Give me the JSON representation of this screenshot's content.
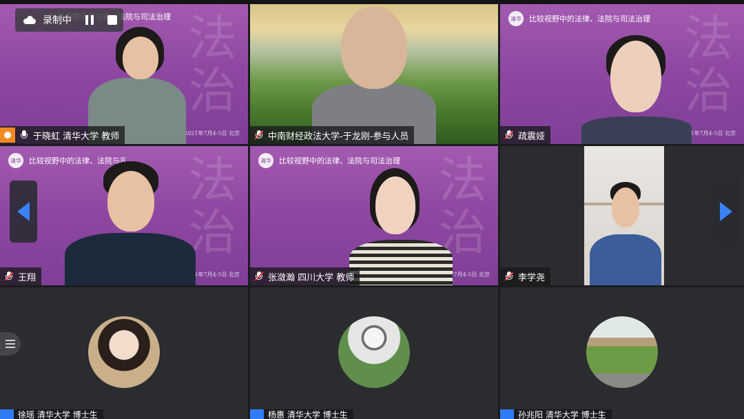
{
  "recording": {
    "label": "录制中"
  },
  "conference": {
    "banner": "比较视野中的法律、法院与司法治理",
    "date": "2021年7月4-5日 北京",
    "seal": "清华",
    "watermark": "法治"
  },
  "tiles": [
    {
      "name": "于晓虹 清华大学 教师",
      "muted": false
    },
    {
      "name": "中南财经政法大学-于龙刚-参与人员",
      "muted": true
    },
    {
      "name": "疏震娅",
      "muted": true
    },
    {
      "name": "王翔",
      "muted": true
    },
    {
      "name": "张潋瀚 四川大学 教师",
      "muted": true
    },
    {
      "name": "李学尧",
      "muted": true
    },
    {
      "name": "徐瑶 清华大学 博士生",
      "muted": true
    },
    {
      "name": "杨惠 清华大学 博士生",
      "muted": true
    },
    {
      "name": "孙兆阳 清华大学 博士生",
      "muted": true
    }
  ],
  "icons": {
    "cloud": "cloud-icon",
    "pause": "pause-icon",
    "stop": "stop-icon",
    "prev": "chevron-left-icon",
    "next": "chevron-right-icon",
    "list": "list-icon",
    "mic": "microphone-icon",
    "avatar": "user-icon"
  },
  "colors": {
    "accent": "#3b82f6",
    "purple": "#8f48a2",
    "orange": "#f08a24",
    "muted": "#ff4141"
  }
}
